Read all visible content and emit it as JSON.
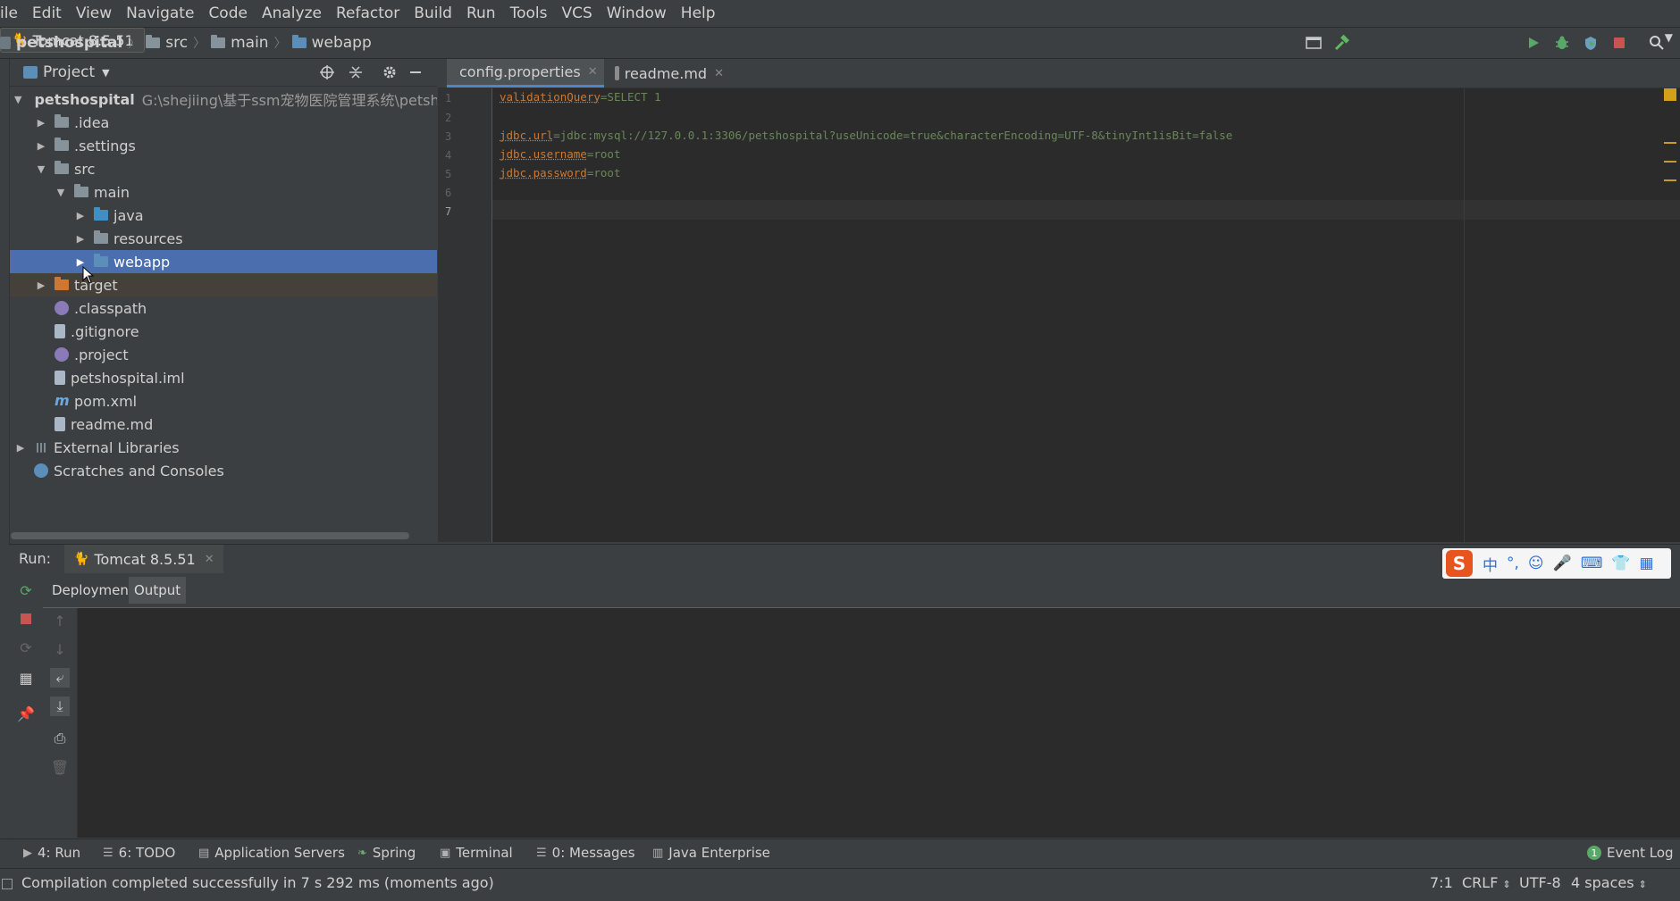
{
  "menu": [
    "ile",
    "Edit",
    "View",
    "Navigate",
    "Code",
    "Analyze",
    "Refactor",
    "Build",
    "Run",
    "Tools",
    "VCS",
    "Window",
    "Help"
  ],
  "breadcrumb": [
    "petshospital",
    "src",
    "main",
    "webapp"
  ],
  "run_config": "Tomcat 8.5.51",
  "project_panel": {
    "title": "Project",
    "tree": [
      {
        "label": "petshospital",
        "path": "G:\\shejiing\\基于ssm宠物医院管理系统\\petshosp"
      },
      {
        "label": ".idea"
      },
      {
        "label": ".settings"
      },
      {
        "label": "src"
      },
      {
        "label": "main"
      },
      {
        "label": "java"
      },
      {
        "label": "resources"
      },
      {
        "label": "webapp"
      },
      {
        "label": "target"
      },
      {
        "label": ".classpath"
      },
      {
        "label": ".gitignore"
      },
      {
        "label": ".project"
      },
      {
        "label": "petshospital.iml"
      },
      {
        "label": "pom.xml"
      },
      {
        "label": "readme.md"
      },
      {
        "label": "External Libraries"
      },
      {
        "label": "Scratches and Consoles"
      }
    ]
  },
  "editor": {
    "tabs": [
      "config.properties",
      "readme.md"
    ],
    "line_numbers": [
      "1",
      "2",
      "3",
      "4",
      "5",
      "6",
      "7"
    ],
    "lines": [
      {
        "key": "validationQuery",
        "value": "=SELECT 1"
      },
      {
        "key": "",
        "value": ""
      },
      {
        "key": "jdbc.url",
        "value": "=jdbc:mysql://127.0.0.1:3306/petshospital?useUnicode=true&characterEncoding=UTF-8&tinyInt1isBit=false"
      },
      {
        "key": "jdbc.username",
        "value": "=root"
      },
      {
        "key": "jdbc.password",
        "value": "=root"
      },
      {
        "key": "",
        "value": ""
      },
      {
        "key": "",
        "value": ""
      }
    ]
  },
  "run_window": {
    "label": "Run:",
    "tab": "Tomcat 8.5.51",
    "subtabs": [
      "Deployment",
      "Output"
    ]
  },
  "tool_windows": [
    "4: Run",
    "6: TODO",
    "Application Servers",
    "Spring",
    "Terminal",
    "0: Messages",
    "Java Enterprise",
    "Event Log"
  ],
  "status": {
    "message": "Compilation completed successfully in 7 s 292 ms (moments ago)",
    "position": "7:1",
    "line_sep": "CRLF",
    "encoding": "UTF-8",
    "indent": "4 spaces"
  },
  "ime": {
    "logo": "S",
    "mode": "中"
  }
}
